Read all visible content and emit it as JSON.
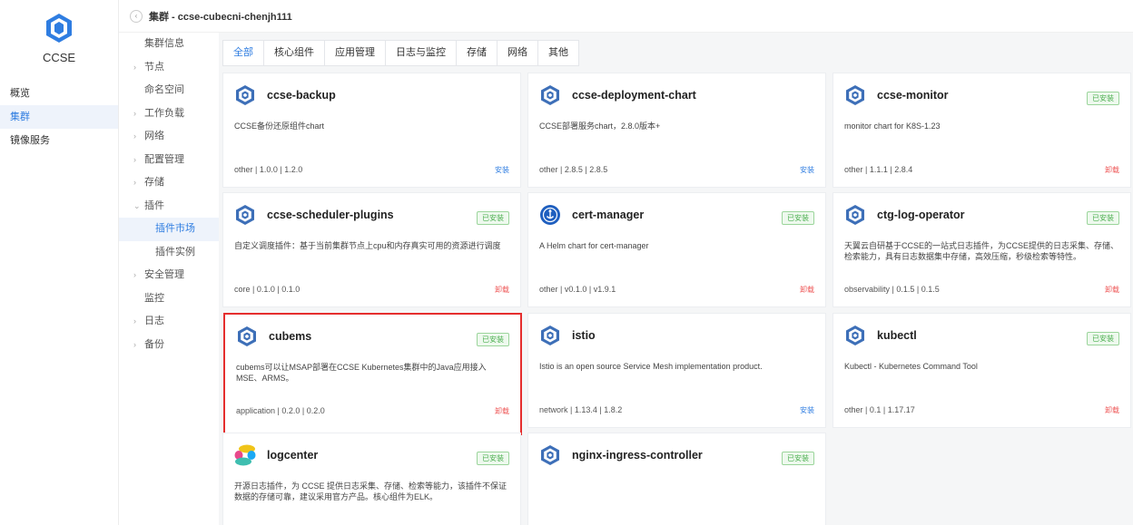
{
  "brand": {
    "name": "CCSE"
  },
  "left_nav": [
    {
      "label": "概览",
      "active": false
    },
    {
      "label": "集群",
      "active": true
    },
    {
      "label": "镜像服务",
      "active": false
    }
  ],
  "header": {
    "title": "集群 - ccse-cubecni-chenjh111"
  },
  "sub_nav": [
    {
      "label": "集群信息",
      "type": "plain"
    },
    {
      "label": "节点",
      "type": "expand"
    },
    {
      "label": "命名空间",
      "type": "plain"
    },
    {
      "label": "工作负载",
      "type": "expand"
    },
    {
      "label": "网络",
      "type": "expand"
    },
    {
      "label": "配置管理",
      "type": "expand"
    },
    {
      "label": "存储",
      "type": "expand"
    },
    {
      "label": "插件",
      "type": "open"
    },
    {
      "label": "插件市场",
      "type": "child",
      "selected": true
    },
    {
      "label": "插件实例",
      "type": "child"
    },
    {
      "label": "安全管理",
      "type": "expand"
    },
    {
      "label": "监控",
      "type": "plain"
    },
    {
      "label": "日志",
      "type": "expand"
    },
    {
      "label": "备份",
      "type": "expand"
    }
  ],
  "tabs": [
    {
      "label": "全部",
      "active": true
    },
    {
      "label": "核心组件"
    },
    {
      "label": "应用管理"
    },
    {
      "label": "日志与监控"
    },
    {
      "label": "存储"
    },
    {
      "label": "网络"
    },
    {
      "label": "其他"
    }
  ],
  "installed_label": "已安装",
  "plugins": [
    {
      "name": "ccse-backup",
      "icon": "helm-hexagon-icon",
      "installed": false,
      "desc": "CCSE备份还原组件chart",
      "meta": "other | 1.0.0 | 1.2.0",
      "action": "安装"
    },
    {
      "name": "ccse-deployment-chart",
      "icon": "helm-hexagon-icon",
      "installed": false,
      "desc": "CCSE部署服务chart，2.8.0版本+",
      "meta": "other | 2.8.5 | 2.8.5",
      "action": "安装"
    },
    {
      "name": "ccse-monitor",
      "icon": "helm-hexagon-icon",
      "installed": true,
      "desc": "monitor chart for K8S-1.23",
      "meta": "other | 1.1.1 | 2.8.4",
      "action": "卸载"
    },
    {
      "name": "ccse-scheduler-plugins",
      "icon": "helm-hexagon-icon",
      "installed": true,
      "desc": "自定义调度插件：基于当前集群节点上cpu和内存真实可用的资源进行调度",
      "meta": "core | 0.1.0 | 0.1.0",
      "action": "卸载"
    },
    {
      "name": "cert-manager",
      "icon": "cert-manager-icon",
      "installed": true,
      "desc": "A Helm chart for cert-manager",
      "meta": "other | v0.1.0 | v1.9.1",
      "action": "卸载"
    },
    {
      "name": "ctg-log-operator",
      "icon": "helm-hexagon-icon",
      "installed": true,
      "desc": "天翼云自研基于CCSE的一站式日志插件，为CCSE提供的日志采集、存储、检索能力，具有日志数据集中存储，高效压缩，秒级检索等特性。",
      "meta": "observability | 0.1.5 | 0.1.5",
      "action": "卸载"
    },
    {
      "name": "cubems",
      "icon": "helm-hexagon-icon",
      "installed": true,
      "desc": "cubems可以让MSAP部署在CCSE Kubernetes集群中的Java应用接入MSE、ARMS。",
      "meta": "application | 0.2.0 | 0.2.0",
      "action": "卸载",
      "highlight": true
    },
    {
      "name": "istio",
      "icon": "helm-hexagon-icon",
      "installed": false,
      "desc": "Istio is an open source Service Mesh implementation product.",
      "meta": "network | 1.13.4 | 1.8.2",
      "action": "安装"
    },
    {
      "name": "kubectl",
      "icon": "helm-hexagon-icon",
      "installed": true,
      "desc": "Kubectl - Kubernetes Command Tool",
      "meta": "other | 0.1 | 1.17.17",
      "action": "卸载"
    },
    {
      "name": "logcenter",
      "icon": "elastic-logo-icon",
      "installed": true,
      "desc": "开源日志插件，为 CCSE 提供日志采集、存储、检索等能力，该插件不保证数据的存储可靠，建议采用官方产品。核心组件为ELK。",
      "meta": "",
      "action": ""
    },
    {
      "name": "nginx-ingress-controller",
      "icon": "helm-hexagon-icon",
      "installed": true,
      "desc": "",
      "meta": "",
      "action": ""
    }
  ],
  "colors": {
    "accent": "#2f7de1",
    "installed": "#4caf50",
    "uninstall": "#e55555",
    "highlight": "#e52e2e"
  }
}
